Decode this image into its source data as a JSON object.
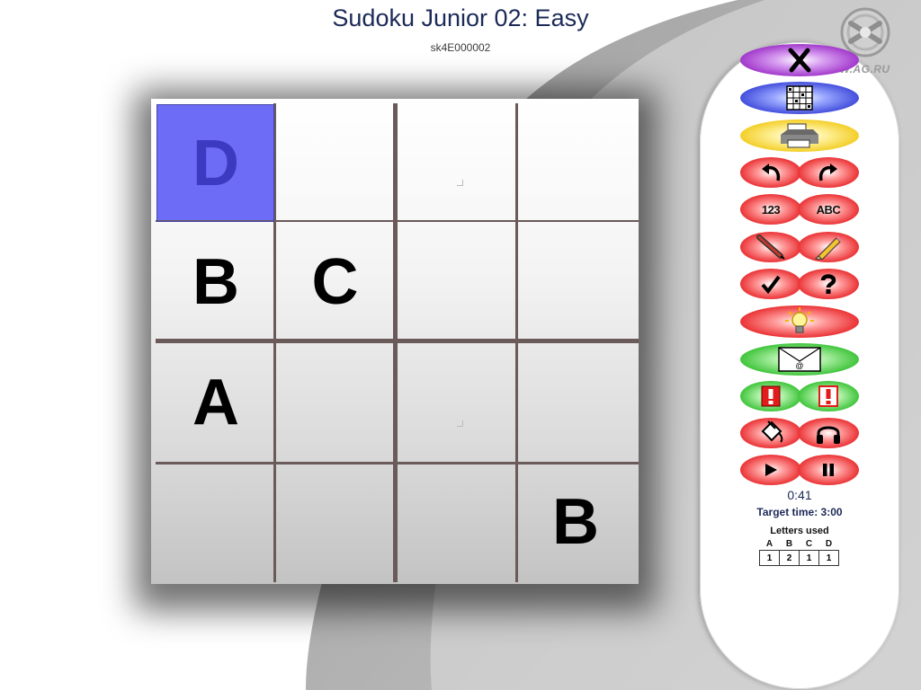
{
  "header": {
    "title": "Sudoku Junior 02: Easy",
    "puzzle_id": "sk4E000002"
  },
  "branding": {
    "site": "WWW.AG.RU",
    "logo_icon": "ag-logo-icon"
  },
  "board": {
    "rows": [
      [
        "D",
        "",
        "",
        ""
      ],
      [
        "B",
        "C",
        "",
        ""
      ],
      [
        "A",
        "",
        "",
        ""
      ],
      [
        "",
        "",
        "",
        "B"
      ]
    ],
    "selected": {
      "row": 1,
      "col": 1
    },
    "selected_color": "#6d6cf6"
  },
  "toolbar": {
    "close": {
      "icon": "close-x-icon",
      "color": "purple"
    },
    "new_puzzle": {
      "icon": "grid-icon",
      "color": "blue"
    },
    "print": {
      "icon": "printer-icon",
      "color": "yellow"
    },
    "undo": {
      "icon": "undo-arrow-icon"
    },
    "redo": {
      "icon": "redo-arrow-icon"
    },
    "numbers_label": "123",
    "letters_label": "ABC",
    "pen": {
      "icon": "pen-icon"
    },
    "pencil": {
      "icon": "pencil-icon"
    },
    "check": {
      "icon": "check-mark-icon"
    },
    "help": {
      "icon": "question-mark-icon"
    },
    "hint": {
      "icon": "light-bulb-icon"
    },
    "email": {
      "icon": "email-envelope-icon",
      "glyph": "@"
    },
    "alert_1": {
      "icon": "exclamation-icon"
    },
    "alert_2": {
      "icon": "exclamation-outline-icon"
    },
    "paint": {
      "icon": "paint-bucket-icon"
    },
    "audio": {
      "icon": "headphones-icon"
    },
    "play": {
      "icon": "play-icon"
    },
    "pause": {
      "icon": "pause-icon"
    }
  },
  "status": {
    "timer": "0:41",
    "target_time": "Target time: 3:00",
    "letters_used_title": "Letters used",
    "letters": [
      "A",
      "B",
      "C",
      "D"
    ],
    "counts": [
      "1",
      "2",
      "1",
      "1"
    ]
  },
  "colors": {
    "title": "#1c2a58",
    "grid_lines": "#6b5a5a",
    "panel": "#ffffff"
  }
}
